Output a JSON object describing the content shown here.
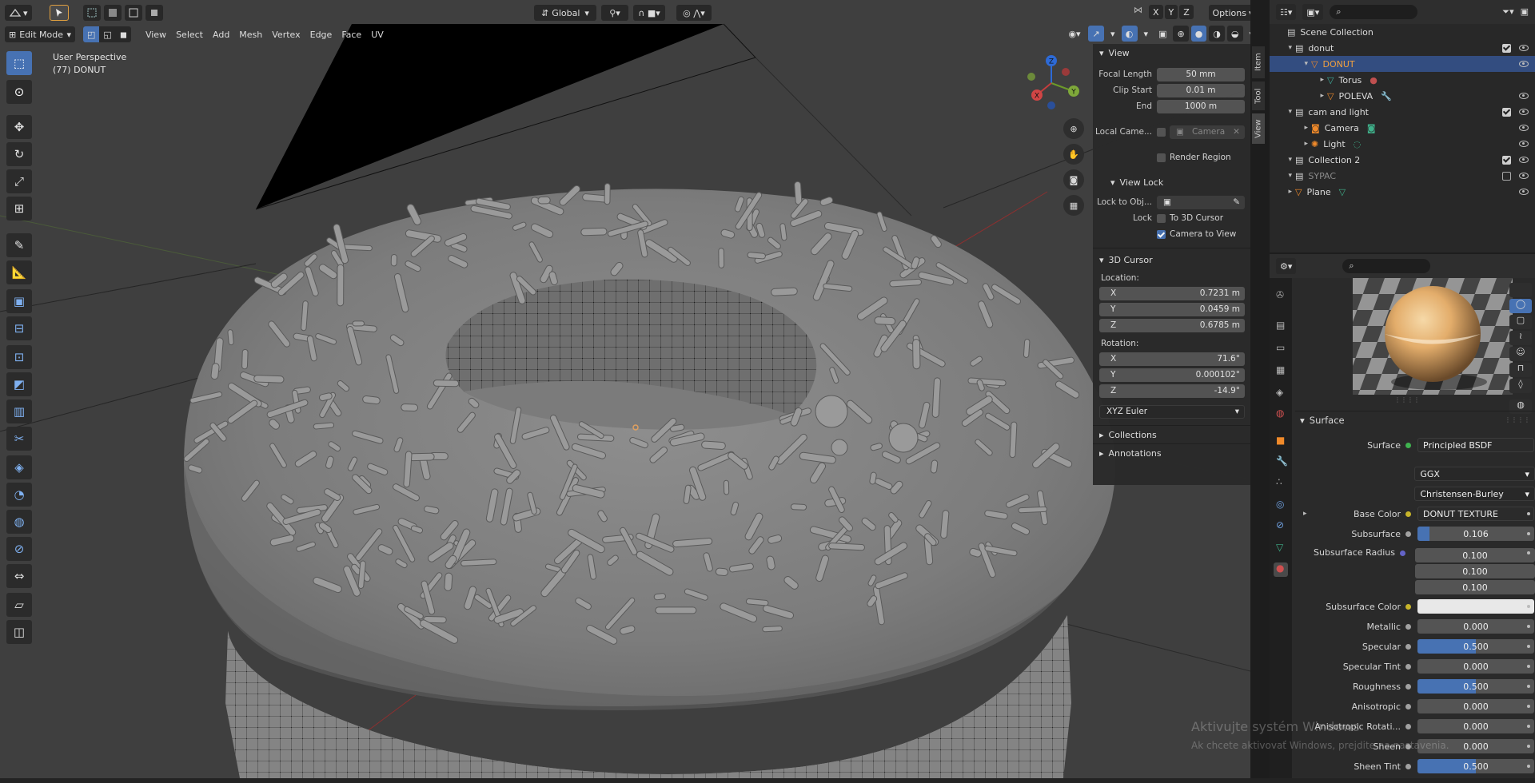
{
  "header": {
    "mode": "Edit Mode",
    "menus": [
      "View",
      "Select",
      "Add",
      "Mesh",
      "Vertex",
      "Edge",
      "Face",
      "UV"
    ],
    "orientation": "Global",
    "options_label": "Options",
    "mirror_axes": [
      "X",
      "Y",
      "Z"
    ]
  },
  "viewport": {
    "perspective_label": "User Perspective",
    "object_label": "(77) DONUT",
    "gizmo_axes": {
      "x": "X",
      "y": "Y",
      "z": "Z"
    }
  },
  "toolbar": {
    "tools": [
      "select-box-tool",
      "cursor-tool",
      "move-tool",
      "rotate-tool",
      "scale-tool",
      "transform-tool",
      "annotate-tool",
      "measure-tool",
      "add-cube-tool",
      "extrude-tool",
      "inset-tool",
      "bevel-tool",
      "loop-cut-tool",
      "knife-tool",
      "poly-build-tool",
      "spin-tool",
      "smooth-tool",
      "edge-slide-tool",
      "shrink-fatten-tool",
      "shear-tool",
      "rip-tool"
    ]
  },
  "n_panel": {
    "tabs": [
      "Item",
      "Tool",
      "View"
    ],
    "active_tab": "View",
    "view_header": "View",
    "focal_length_label": "Focal Length",
    "focal_length": "50 mm",
    "clip_start_label": "Clip Start",
    "clip_start": "0.01 m",
    "clip_end_label": "End",
    "clip_end": "1000 m",
    "local_camera_label": "Local Came...",
    "local_camera_placeholder": "Camera",
    "render_region_label": "Render Region",
    "view_lock_header": "View Lock",
    "lock_to_obj_label": "Lock to Obj...",
    "lock_label": "Lock",
    "to_3d_cursor_label": "To 3D Cursor",
    "camera_to_view_label": "Camera to View",
    "cursor_header": "3D Cursor",
    "location_label": "Location:",
    "location": {
      "x": "0.7231 m",
      "y": "0.0459 m",
      "z": "0.6785 m"
    },
    "rotation_label": "Rotation:",
    "rotation": {
      "x": "71.6°",
      "y": "0.000102°",
      "z": "-14.9°"
    },
    "rotation_mode": "XYZ Euler",
    "axis_labels": {
      "x": "X",
      "y": "Y",
      "z": "Z"
    },
    "collections_header": "Collections",
    "annotations_header": "Annotations"
  },
  "outliner": {
    "root": "Scene Collection",
    "rows": [
      {
        "label": "donut",
        "icon": "collection-icon",
        "indent": 1,
        "check": "on",
        "eye": true
      },
      {
        "label": "DONUT",
        "icon": "mesh-object-icon",
        "indent": 2,
        "selected": true,
        "eye": true
      },
      {
        "label": "Torus",
        "icon": "mesh-data-icon",
        "indent": 3,
        "extra": "material-icon",
        "eye": false
      },
      {
        "label": "POLEVA",
        "icon": "mesh-object-icon",
        "indent": 3,
        "extra": "modifier-icon",
        "eye": true
      },
      {
        "label": "cam and light",
        "icon": "collection-icon",
        "indent": 1,
        "check": "on",
        "eye": true
      },
      {
        "label": "Camera",
        "icon": "camera-icon",
        "indent": 2,
        "extra": "camera-data-icon",
        "eye": true
      },
      {
        "label": "Light",
        "icon": "light-icon",
        "indent": 2,
        "extra": "light-data-icon",
        "eye": true
      },
      {
        "label": "Collection 2",
        "icon": "collection-icon",
        "indent": 1,
        "check": "on",
        "eye": true
      },
      {
        "label": "SYPAC",
        "icon": "collection-icon",
        "indent": 1,
        "check": "off",
        "eye": true
      },
      {
        "label": "Plane",
        "icon": "mesh-object-icon",
        "indent": 1,
        "extra": "mesh-data-icon",
        "eye": true
      }
    ]
  },
  "properties": {
    "surface_header": "Surface",
    "surface_label": "Surface",
    "surface_value": "Principled BSDF",
    "distribution": "GGX",
    "subsurface_method": "Christensen-Burley",
    "rows": [
      {
        "label": "Base Color",
        "value": "DONUT TEXTURE",
        "dot": "#c7b42a",
        "kind": "link"
      },
      {
        "label": "Subsurface",
        "value": "0.106",
        "fill": 0.106,
        "dot": "#a1a1a1"
      },
      {
        "label": "Subsurface Radius",
        "values": [
          "0.100",
          "0.100",
          "0.100"
        ],
        "dot": "#6363c7"
      },
      {
        "label": "Subsurface Color",
        "dot": "#c7b42a",
        "kind": "color",
        "color": "#e8e8e8"
      },
      {
        "label": "Metallic",
        "value": "0.000",
        "fill": 0,
        "dot": "#a1a1a1"
      },
      {
        "label": "Specular",
        "value": "0.500",
        "fill": 0.5,
        "dot": "#a1a1a1"
      },
      {
        "label": "Specular Tint",
        "value": "0.000",
        "fill": 0,
        "dot": "#a1a1a1"
      },
      {
        "label": "Roughness",
        "value": "0.500",
        "fill": 0.5,
        "dot": "#a1a1a1"
      },
      {
        "label": "Anisotropic",
        "value": "0.000",
        "fill": 0,
        "dot": "#a1a1a1"
      },
      {
        "label": "Anisotropic Rotati...",
        "value": "0.000",
        "fill": 0,
        "dot": "#a1a1a1"
      },
      {
        "label": "Sheen",
        "value": "0.000",
        "fill": 0,
        "dot": "#a1a1a1"
      },
      {
        "label": "Sheen Tint",
        "value": "0.500",
        "fill": 0.5,
        "dot": "#a1a1a1"
      }
    ]
  },
  "watermark": {
    "line1": "Aktivujte systém Windows",
    "line2": "Ak chcete aktivovať Windows, prejdite na nastavenia."
  },
  "colors": {
    "accent": "#4772b3",
    "selected_row": "#334d80",
    "panel": "#2a2a2a",
    "viewport": "#3d3d3d"
  }
}
